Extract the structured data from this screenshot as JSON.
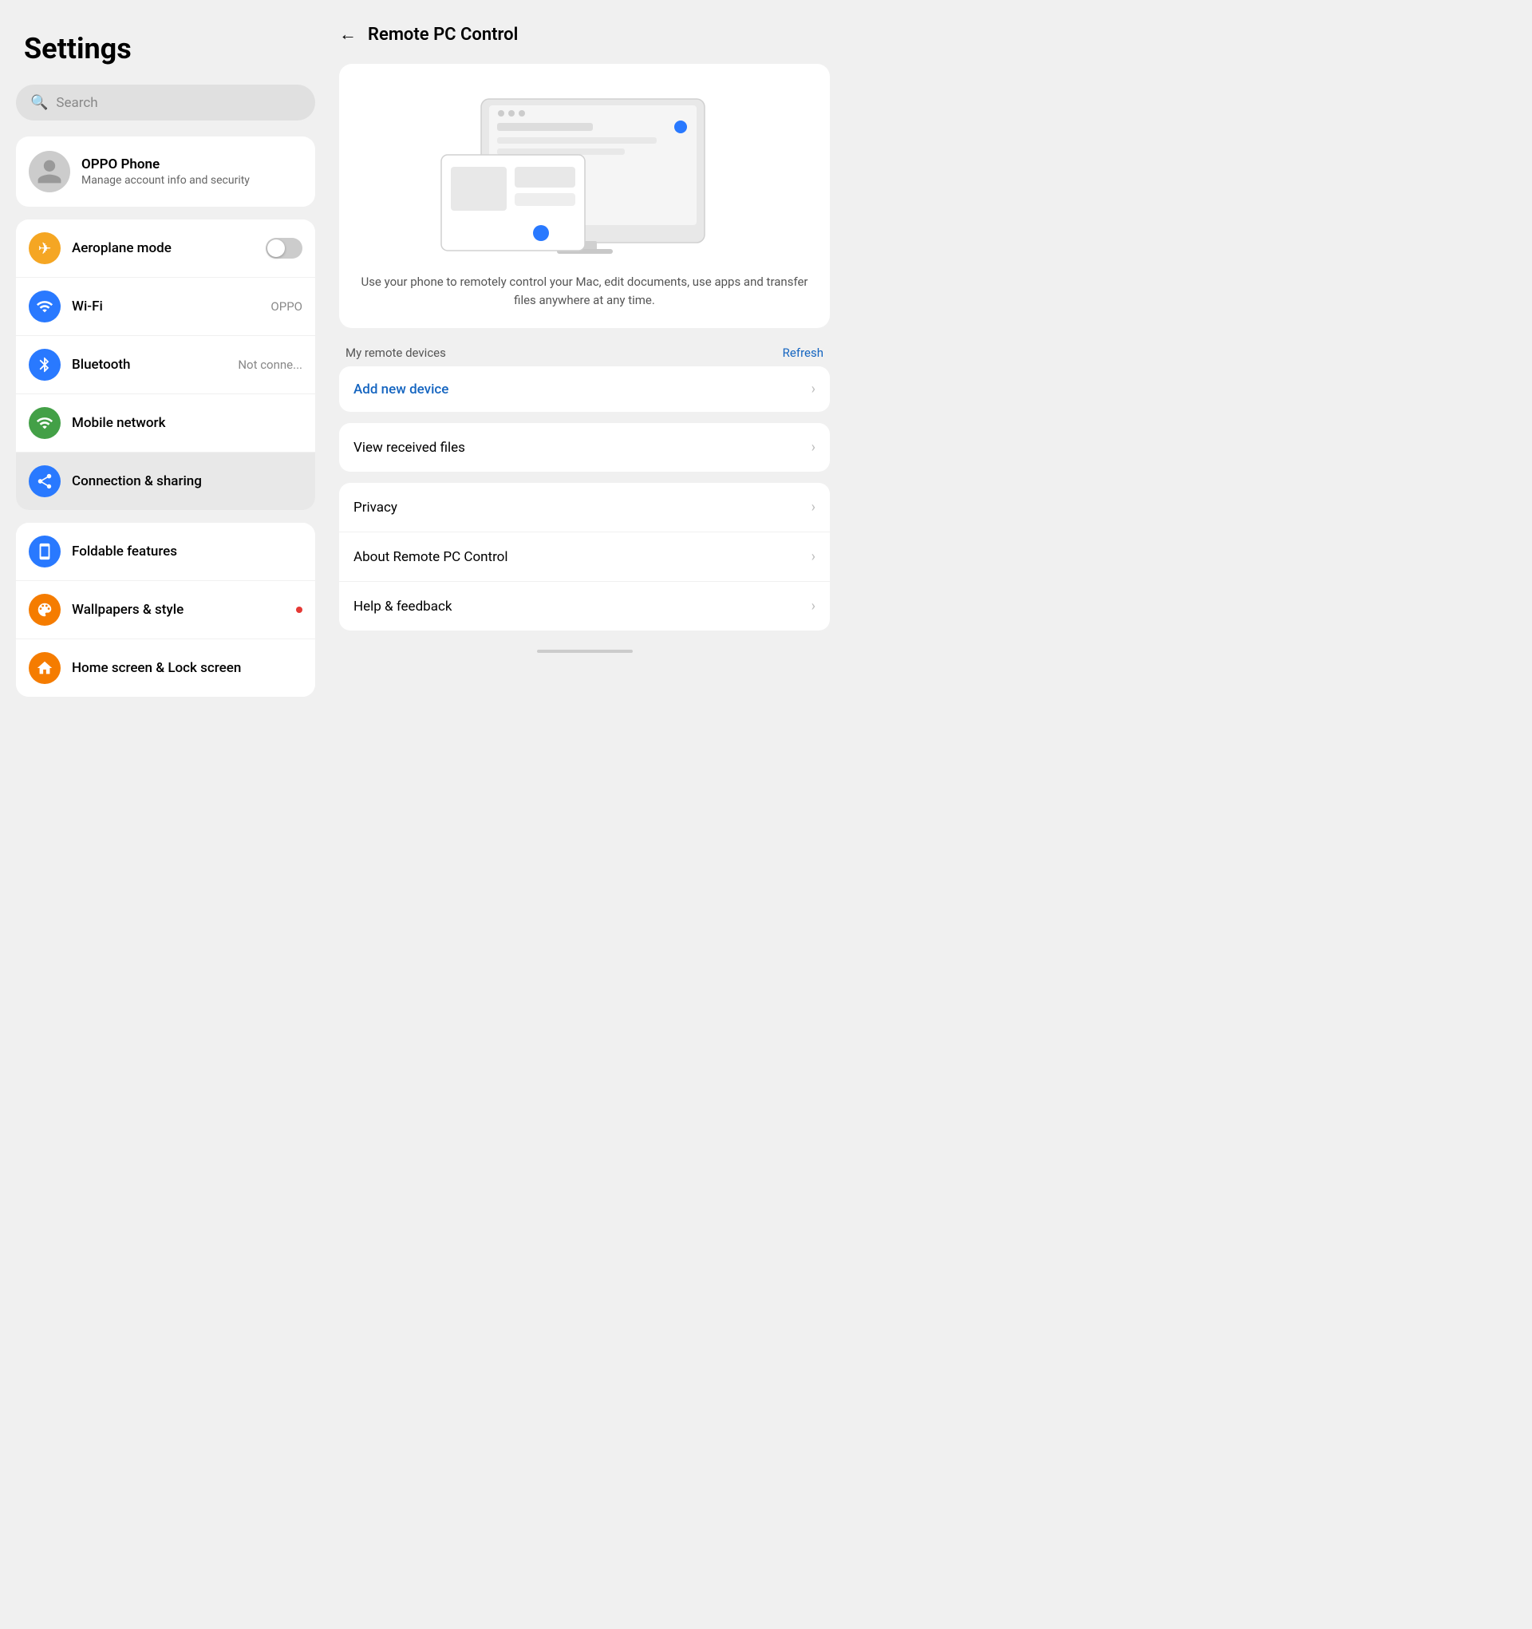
{
  "sidebar": {
    "title": "Settings",
    "search": {
      "placeholder": "Search"
    },
    "account": {
      "name": "OPPO Phone",
      "subtitle": "Manage account info and security"
    },
    "items": [
      {
        "id": "aeroplane",
        "label": "Aeroplane mode",
        "icon": "✈",
        "icon_color": "icon-orange",
        "has_toggle": true,
        "toggle_on": false
      },
      {
        "id": "wifi",
        "label": "Wi-Fi",
        "icon": "wifi",
        "icon_color": "icon-blue",
        "value": "OPPO"
      },
      {
        "id": "bluetooth",
        "label": "Bluetooth",
        "icon": "bluetooth",
        "icon_color": "icon-blue",
        "value": "Not conne..."
      },
      {
        "id": "mobile-network",
        "label": "Mobile network",
        "icon": "signal",
        "icon_color": "icon-green"
      },
      {
        "id": "connection-sharing",
        "label": "Connection & sharing",
        "icon": "share",
        "icon_color": "icon-blue",
        "active": true
      }
    ],
    "items2": [
      {
        "id": "foldable",
        "label": "Foldable features",
        "icon": "fold",
        "icon_color": "icon-blue"
      },
      {
        "id": "wallpapers",
        "label": "Wallpapers & style",
        "icon": "palette",
        "icon_color": "icon-orange2",
        "has_dot": true
      },
      {
        "id": "homescreen",
        "label": "Home screen & Lock screen",
        "icon": "home",
        "icon_color": "icon-orange2"
      }
    ]
  },
  "right_panel": {
    "back_label": "←",
    "title": "Remote PC Control",
    "hero_desc": "Use your phone to remotely control your Mac, edit documents, use apps and transfer files anywhere at any time.",
    "devices_label": "My remote devices",
    "refresh_label": "Refresh",
    "add_device_label": "Add new device",
    "menu_items": [
      {
        "label": "View received files"
      },
      {
        "label": "Privacy"
      },
      {
        "label": "About Remote PC Control"
      },
      {
        "label": "Help & feedback"
      }
    ]
  }
}
